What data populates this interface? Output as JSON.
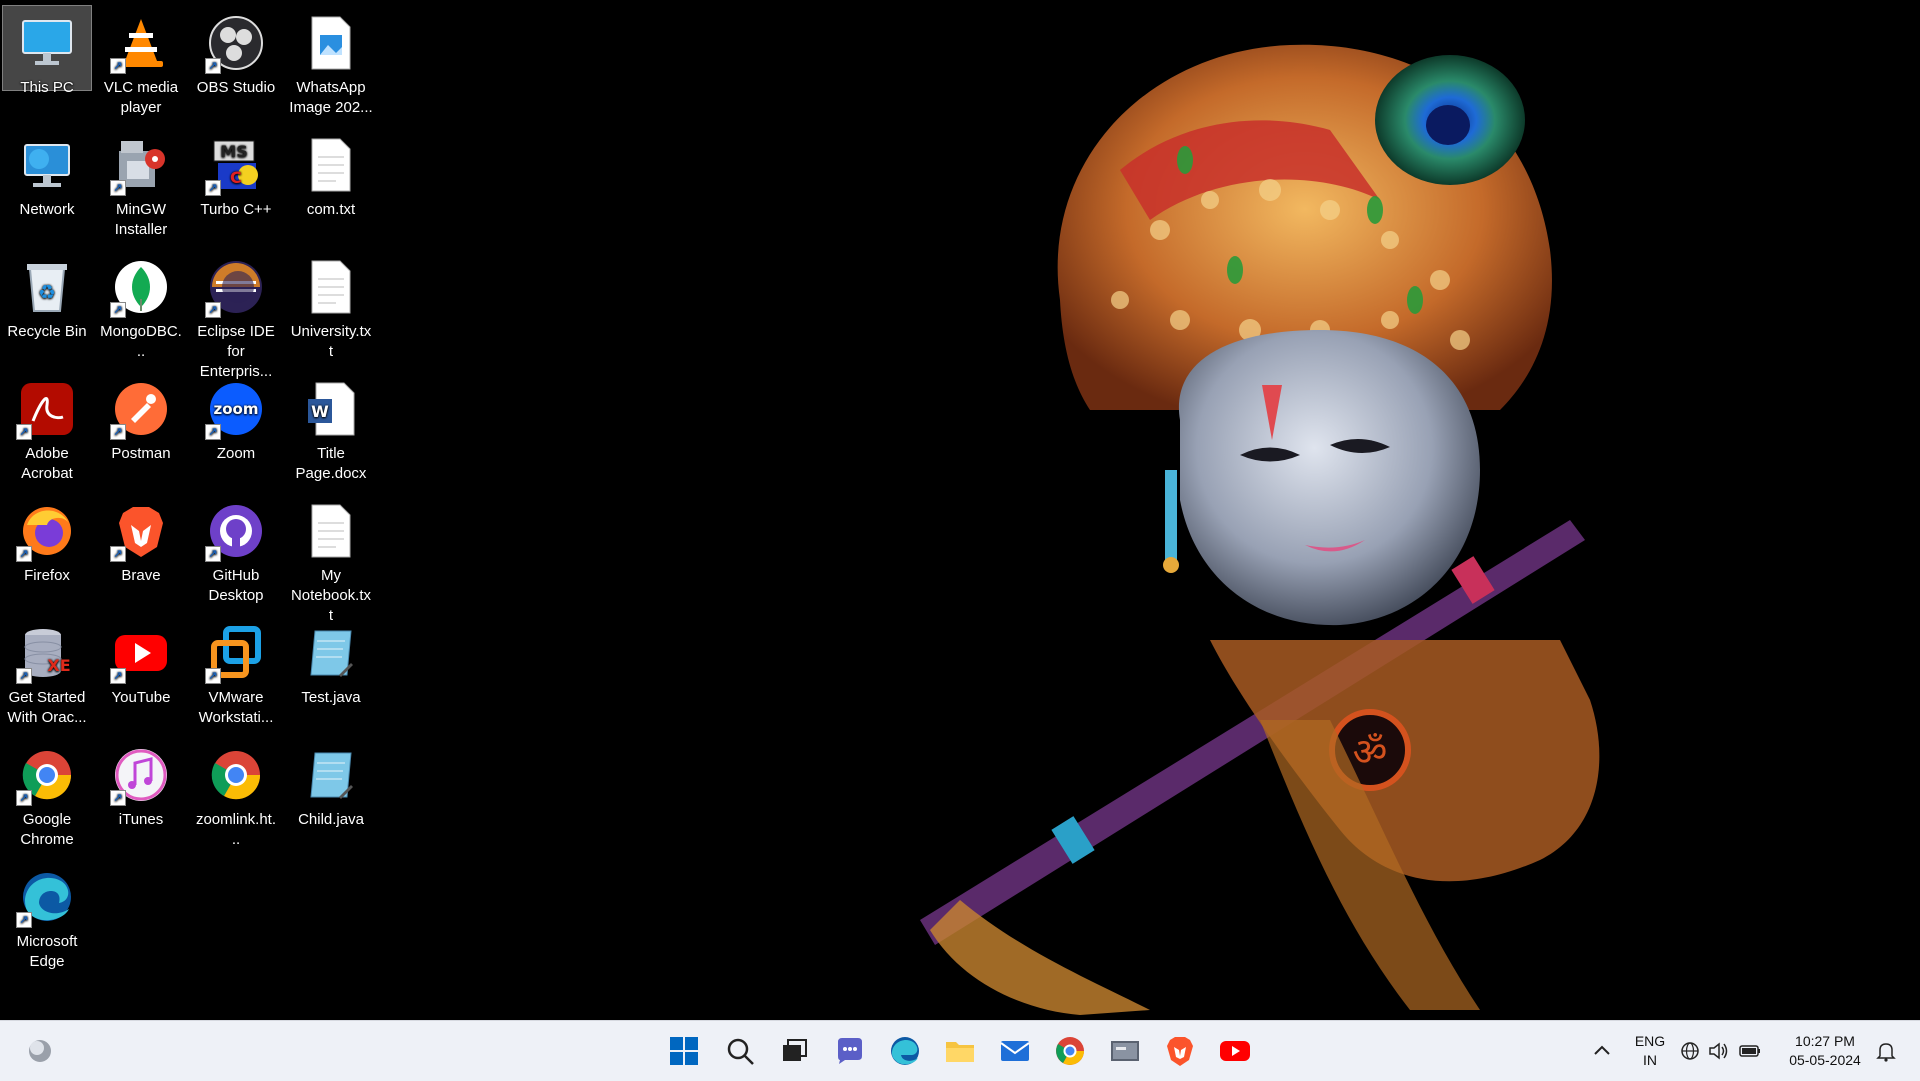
{
  "desktop": {
    "icons": [
      {
        "label": "This PC"
      },
      {
        "label": "VLC media player"
      },
      {
        "label": "OBS Studio"
      },
      {
        "label": "WhatsApp Image 202..."
      },
      {
        "label": "Network"
      },
      {
        "label": "MinGW Installer"
      },
      {
        "label": "Turbo C++"
      },
      {
        "label": "com.txt"
      },
      {
        "label": "Recycle Bin"
      },
      {
        "label": "MongoDBC..."
      },
      {
        "label": "Eclipse IDE for Enterpris..."
      },
      {
        "label": "University.txt"
      },
      {
        "label": "Adobe Acrobat"
      },
      {
        "label": "Postman"
      },
      {
        "label": "Zoom"
      },
      {
        "label": "Title Page.docx"
      },
      {
        "label": "Firefox"
      },
      {
        "label": "Brave"
      },
      {
        "label": "GitHub Desktop"
      },
      {
        "label": "My Notebook.txt"
      },
      {
        "label": "Get Started With Orac..."
      },
      {
        "label": "YouTube"
      },
      {
        "label": "VMware Workstati..."
      },
      {
        "label": "Test.java"
      },
      {
        "label": "Google Chrome"
      },
      {
        "label": "iTunes"
      },
      {
        "label": "zoomlink.ht..."
      },
      {
        "label": "Child.java"
      },
      {
        "label": "Microsoft Edge"
      }
    ],
    "zoom_logo_text": "zoom",
    "turbo_logo_text": "MS",
    "word_logo_text": "W",
    "oracle_logo_text": "XE"
  },
  "taskbar": {
    "language": "ENG",
    "region": "IN",
    "time": "10:27 PM",
    "date": "05-05-2024"
  },
  "colors": {
    "taskbar_bg": "#eef1f7",
    "win_blue": "#0067c0",
    "youtube_red": "#ff0000",
    "brave_orange": "#fb542b"
  }
}
